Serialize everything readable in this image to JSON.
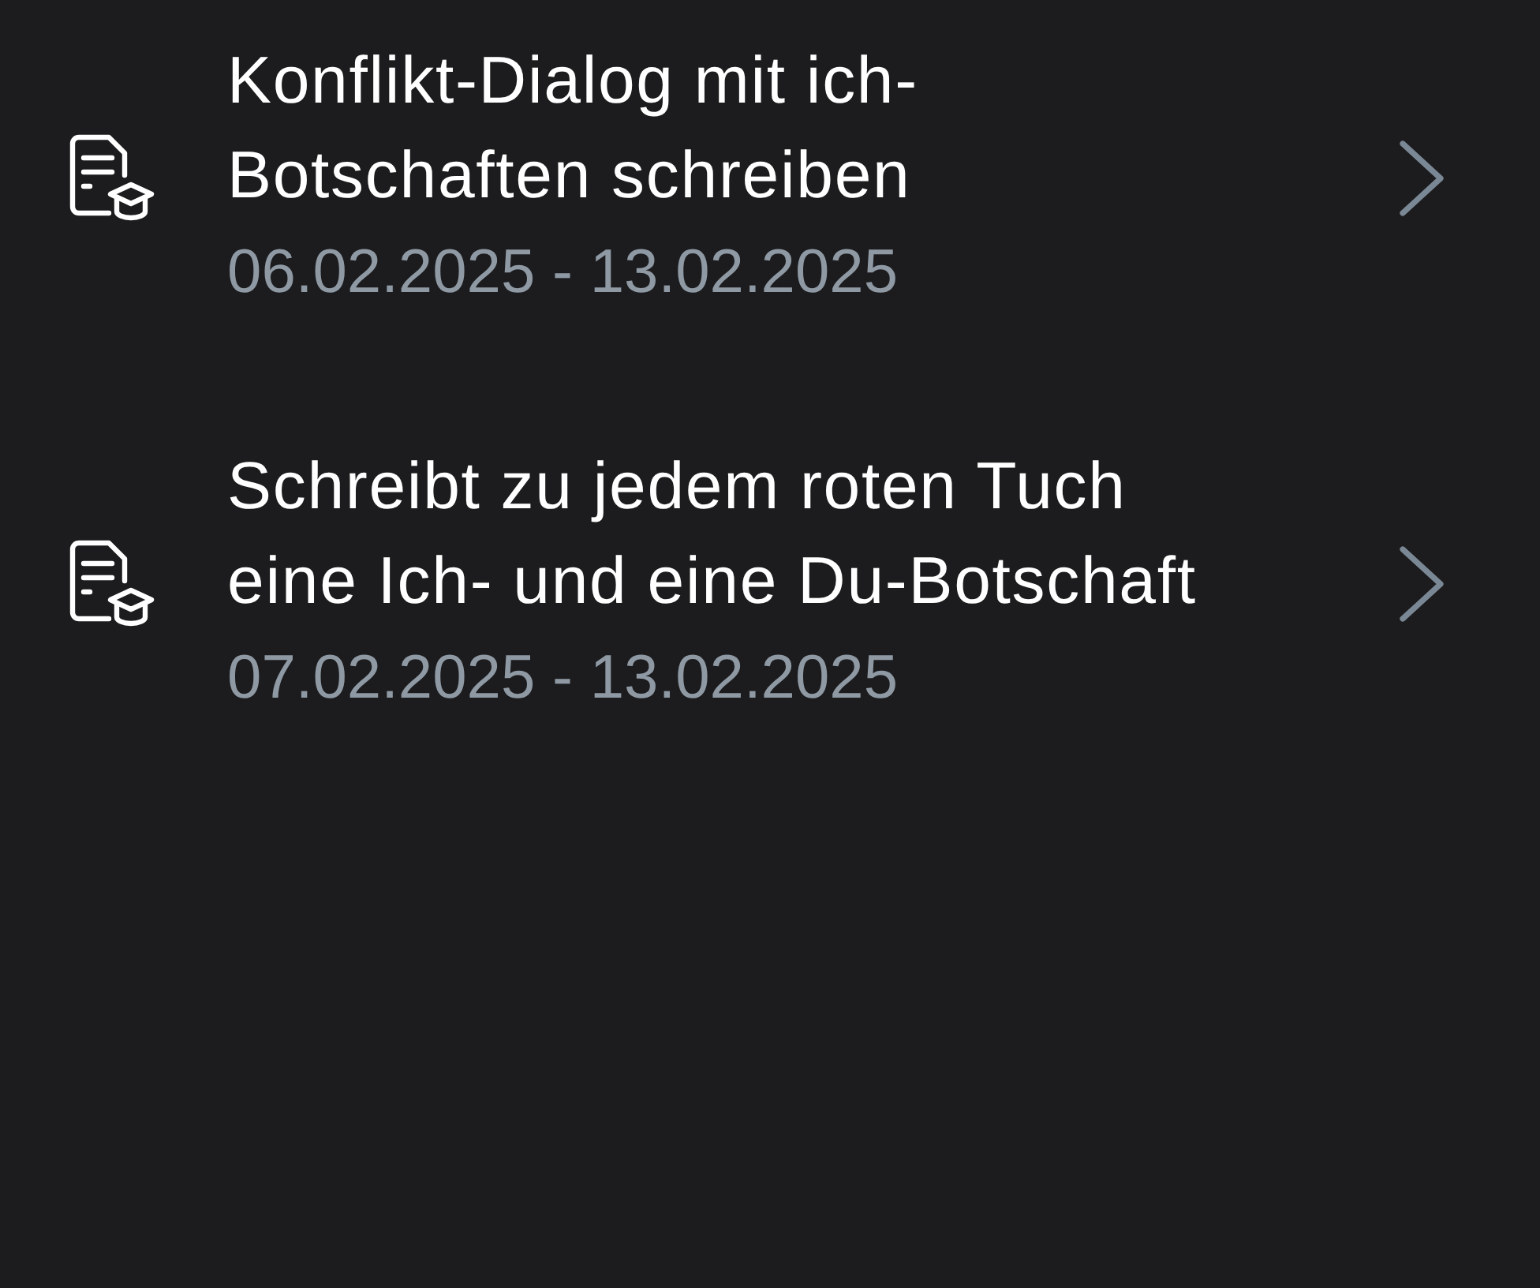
{
  "assignments": [
    {
      "title_lines": [
        "Konflikt-Dialog mit ich-",
        "Botschaften schreiben"
      ],
      "dates": "06.02.2025 - 13.02.2025"
    },
    {
      "title_lines": [
        "Schreibt zu jedem roten Tuch",
        "eine Ich- und eine Du-Botschaft"
      ],
      "dates": "07.02.2025 - 13.02.2025"
    }
  ]
}
